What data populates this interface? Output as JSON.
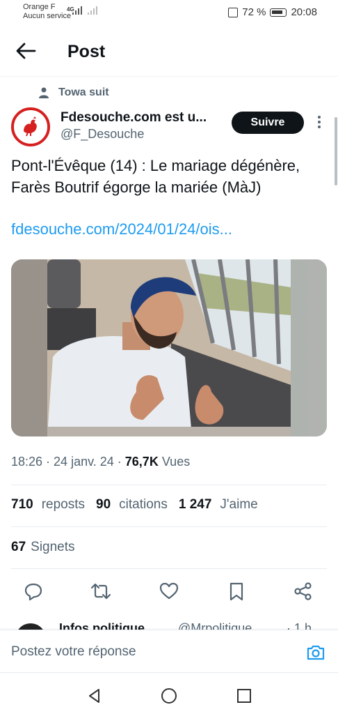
{
  "status_bar": {
    "carrier_line1": "Orange F",
    "carrier_line2": "Aucun service",
    "network": "4G",
    "battery": "72 %",
    "time": "20:08"
  },
  "header": {
    "title": "Post"
  },
  "social_context": "Towa suit",
  "author": {
    "name": "Fdesouche.com est u...",
    "handle": "@F_Desouche",
    "follow_label": "Suivre"
  },
  "post": {
    "text": "Pont-l'Évêque (14) : Le mariage dégénère, Farès Boutrif égorge la mariée (MàJ)",
    "link": "fdesouche.com/2024/01/24/ois..."
  },
  "meta": {
    "time": "18:26",
    "date": "24 janv. 24",
    "views_count": "76,7K",
    "views_label": "Vues"
  },
  "stats": {
    "reposts_count": "710",
    "reposts_label": "reposts",
    "quotes_count": "90",
    "quotes_label": "citations",
    "likes_count": "1 247",
    "likes_label": "J'aime",
    "bookmarks_count": "67",
    "bookmarks_label": "Signets"
  },
  "actions": [
    "reply-icon",
    "repost-icon",
    "like-icon",
    "bookmark-icon",
    "share-icon"
  ],
  "next_post": {
    "name": "Infos politique",
    "handle": "@Mrpolitique",
    "time": "· 1 h"
  },
  "reply": {
    "placeholder": "Postez votre réponse"
  },
  "colors": {
    "accent": "#1d9bf0",
    "text": "#0f1419",
    "secondary": "#536471",
    "follow_bg": "#0f1419",
    "avatar_red": "#d61f1f"
  }
}
